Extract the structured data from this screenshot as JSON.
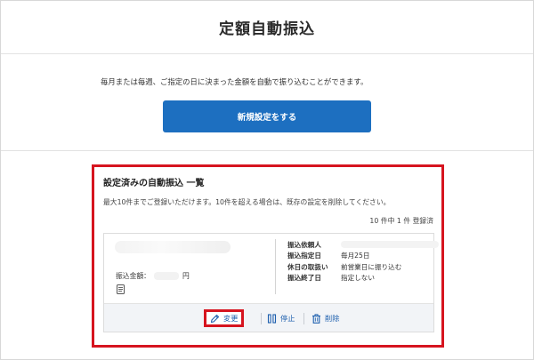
{
  "header": {
    "title": "定額自動振込"
  },
  "intro": {
    "text": "毎月または毎週、ご指定の日に決まった金額を自動で振り込むことができます。",
    "new_button_label": "新規設定をする"
  },
  "panel": {
    "title": "設定済みの自動振込 一覧",
    "note": "最大10件までご登録いただけます。10件を超える場合は、既存の設定を削除してください。",
    "count": "10 件中 1 件 登録済"
  },
  "card": {
    "amount_label": "振込金額：",
    "amount_unit": "円",
    "details": [
      {
        "label": "振込依頼人",
        "value": ""
      },
      {
        "label": "振込指定日",
        "value": "毎月25日"
      },
      {
        "label": "休日の取扱い",
        "value": "前営業日に振り込む"
      },
      {
        "label": "振込終了日",
        "value": "指定しない"
      }
    ],
    "actions": {
      "edit": "変更",
      "stop": "停止",
      "delete": "削除"
    }
  },
  "colors": {
    "primary": "#1d6fc0",
    "highlight": "#d6141f",
    "link": "#1d5fae"
  }
}
